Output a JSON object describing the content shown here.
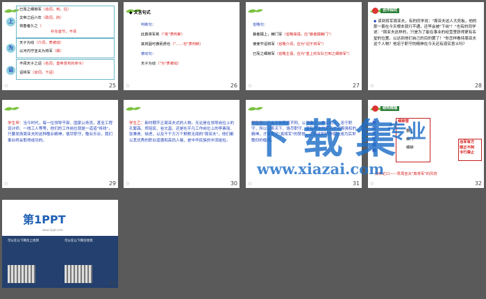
{
  "slides": [
    {
      "number": "25",
      "lines": [
        {
          "key": "上",
          "text": "已而之细柳军",
          "hl": "（动词，到，往）"
        },
        {
          "text": "文帝之后六年",
          "hl": "（助词，的）"
        },
        {
          "text": "将善者久之",
          "hl": "（",
          "hl2": "补充音节，不译"
        },
        {
          "key": "为",
          "text": "天子为动",
          "hl": "（介词，表被动）"
        },
        {
          "text": "以河内守亚夫为将军",
          "hl": "（做）"
        },
        {
          "key": "诏",
          "text": "不闻天子之诏",
          "hl": "（名词，皇帝发布的命令）"
        },
        {
          "text": "诏将军",
          "hl": "（动词，下诏）"
        }
      ]
    },
    {
      "number": "26",
      "title": "文言句式",
      "lines": [
        {
          "label": "判断句：",
          "text": "此真将军矣",
          "hl": "（\"矣\"表判断）"
        },
        {
          "text": "其将固可袭而虏也",
          "hl": "（\"……也\"表判断）"
        },
        {
          "label": "被动句：",
          "text": "天子为动",
          "hl": "（\"为\"表被动）"
        }
      ]
    },
    {
      "number": "27",
      "lines": [
        {
          "label": "省略句："
        },
        {
          "text": "暴者辍上，棘门军",
          "hl": "（省略谓语，应\"暴者辍棘门\"）"
        },
        {
          "text": "使使节诏将军",
          "hl": "（省略介词，应为\"诏于将军\"）"
        },
        {
          "text": "已而之细柳军",
          "hl": "（省略主语，应为\"皇上的车队已到之细柳军\"）"
        }
      ]
    },
    {
      "number": "28",
      "badge": "合作探究",
      "question": "读到将军周亚夫，有的同学说：\"周亚夫这人大死板，他的那一套在今天根本就行不通，还早会被\"下岗\"！\"也有的同学说：\"周亚夫这样的，只是为了能在事业的经营里获得更有名堂的位置，以达到他们自己的目的罢了！\"你怎样看待周亚夫这个人物？他忠于职守的精神在今天还有现实意义吗？"
    },
    {
      "number": "29",
      "label": "学生甲：",
      "text": "当今时代，每一位领导干部、国家公务员，甚至工程设计师、一线工人等等，他们的工作岗位就是一道道\"将线\"，只要发扬周亚夫的这种敬业精神，恪尽职守，敬业乐业，我们事业终会取得成功的。"
    },
    {
      "number": "30",
      "label": "学生乙：",
      "text": "新时期不乏周亚夫式的人物。无论是在领导岗位上的孔繁森、郑培民、谷文昌，还是在平凡工作岗位上的李素丽、张秉贵、徐虎，以及千千万万个默默无闻的\"周亚夫\"，他们都以其优秀的职业道德和高尚人格，是中华民族的中流砥柱。"
    },
    {
      "number": "31",
      "label": "学生丙：",
      "text": "正由于他刚直不阿、公正廉洁、秉公执法、忠于职守，所以心系天下、恪尽职守、富有威信的周亚夫不畏强权的精神，才换来了\"真将军\"的赞誉，正是这种精神使它成为后世敬仰的楷模。"
    },
    {
      "number": "32",
      "badge": "结构梳理",
      "title": "周亚夫军细柳",
      "items": [
        "细柳营",
        "霸上",
        "棘门",
        "细柳",
        "文帝之口——赞周亚夫\"真将军\"的风范"
      ],
      "right": "治军有方 刚正不阿 令行禁止"
    },
    {
      "number": "33",
      "logo": "第1PPT",
      "site": "www.1ppt.com",
      "left_title": "可以在以下网页上找到",
      "right_title": "可以在以下网页找到"
    }
  ],
  "watermark": {
    "main": "下载集",
    "side": "专业",
    "url": "www.xiazai.com"
  }
}
